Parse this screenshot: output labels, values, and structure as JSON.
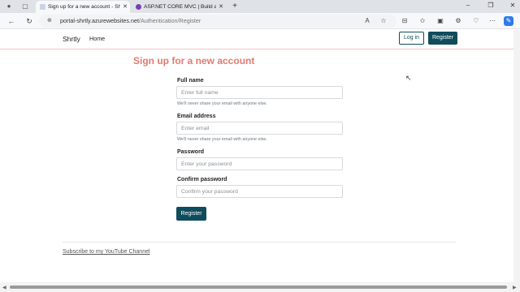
{
  "browser": {
    "tabs": [
      {
        "title": "Sign up for a new account - Shrtly",
        "active": true
      },
      {
        "title": "ASP.NET CORE MVC | Build a Com",
        "active": false
      }
    ],
    "new_tab_glyph": "+",
    "close_glyph": "✕",
    "address": {
      "host": "portal-shrtly.azurewebsites.net",
      "path": "/Authentication/Register"
    },
    "icons": {
      "back": "←",
      "reload": "↻",
      "lock": "🔒",
      "read_aloud": "A",
      "favorite": "☆",
      "split": "⊟",
      "favorites": "✩",
      "collections": "▣",
      "extensions": "⚙",
      "copilot": "✎",
      "minimize": "–",
      "restore": "❐",
      "close": "✕"
    },
    "colors": {
      "accent": "#0f4c5c",
      "title": "#e07a6e"
    }
  },
  "site": {
    "brand": "Shrtly",
    "home": "Home",
    "login": "Log in",
    "register": "Register"
  },
  "form": {
    "title": "Sign up for a new account",
    "full_name": {
      "label": "Full name",
      "placeholder": "Enter full name",
      "hint": "We'll never share your email with anyone else."
    },
    "email": {
      "label": "Email address",
      "placeholder": "Enter email",
      "hint": "We'll never share your email with anyone else."
    },
    "password": {
      "label": "Password",
      "placeholder": "Enter your password"
    },
    "confirm": {
      "label": "Confirm password",
      "placeholder": "Confirm your password"
    },
    "submit": "Register"
  },
  "footer": {
    "link": "Subscribe to my YouTube Channel"
  }
}
